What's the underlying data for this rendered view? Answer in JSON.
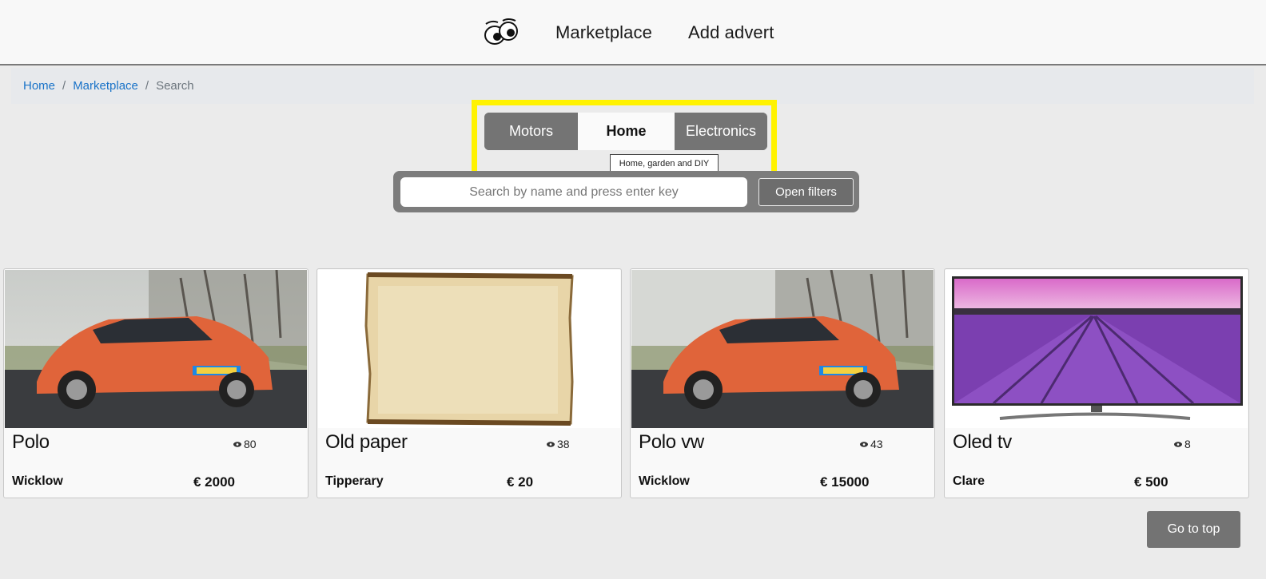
{
  "nav": {
    "logo_icon": "eyes-logo-icon",
    "marketplace": "Marketplace",
    "add_advert": "Add advert"
  },
  "breadcrumb": {
    "items": [
      "Home",
      "Marketplace"
    ],
    "current": "Search"
  },
  "categories": {
    "tabs": [
      {
        "label": "Motors",
        "active": false
      },
      {
        "label": "Home",
        "active": true
      },
      {
        "label": "Electronics",
        "active": false
      }
    ],
    "tooltip": "Home, garden and DIY"
  },
  "search": {
    "placeholder": "Search by name and press enter key",
    "filters_button": "Open filters"
  },
  "listings": [
    {
      "title": "Polo",
      "views": "80",
      "location": "Wicklow",
      "price": "€ 2000",
      "image": "orange-car"
    },
    {
      "title": "Old paper",
      "views": "38",
      "location": "Tipperary",
      "price": "€ 20",
      "image": "parchment"
    },
    {
      "title": "Polo vw",
      "views": "43",
      "location": "Wicklow",
      "price": "€ 15000",
      "image": "orange-car"
    },
    {
      "title": "Oled tv",
      "views": "8",
      "location": "Clare",
      "price": "€ 500",
      "image": "tv-lavender"
    }
  ],
  "go_to_top": "Go to top",
  "colors": {
    "highlight": "#fff200",
    "link": "#1a73c8",
    "button_gray": "#747474",
    "car": "#e0643a"
  }
}
